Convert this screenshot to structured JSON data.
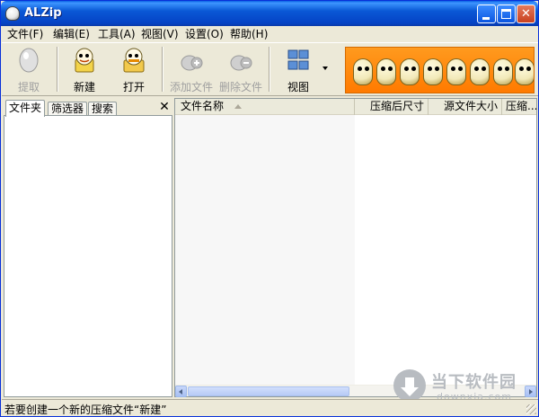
{
  "window": {
    "title": "ALZip"
  },
  "menu": [
    {
      "label": "文件(F)"
    },
    {
      "label": "编辑(E)"
    },
    {
      "label": "工具(A)"
    },
    {
      "label": "视图(V)"
    },
    {
      "label": "设置(O)"
    },
    {
      "label": "帮助(H)"
    }
  ],
  "toolbar": {
    "extract": {
      "label": "提取",
      "icon": "extract-egg-icon",
      "enabled": false
    },
    "new": {
      "label": "新建",
      "icon": "new-archive-icon",
      "enabled": true
    },
    "open": {
      "label": "打开",
      "icon": "open-archive-icon",
      "enabled": true
    },
    "add_files": {
      "label": "添加文件",
      "icon": "add-files-icon",
      "enabled": false
    },
    "delete_files": {
      "label": "删除文件",
      "icon": "delete-files-icon",
      "enabled": false
    },
    "view": {
      "label": "视图",
      "icon": "view-grid-icon",
      "enabled": true
    }
  },
  "left_panel": {
    "tabs": [
      "文件夹",
      "筛选器",
      "搜索"
    ],
    "active_tab": "文件夹",
    "close_glyph": "✕"
  },
  "file_list": {
    "columns": [
      "文件名称",
      "压缩后尺寸",
      "源文件大小",
      "压缩..."
    ]
  },
  "status": {
    "text": "若要创建一个新的压缩文件“新建”"
  },
  "watermark": {
    "title": "当下软件园",
    "subtitle": "downxia.com"
  },
  "colors": {
    "titlebar": "#0a58d6",
    "banner": "#ff8a0e",
    "window_bg": "#ece9d8"
  }
}
